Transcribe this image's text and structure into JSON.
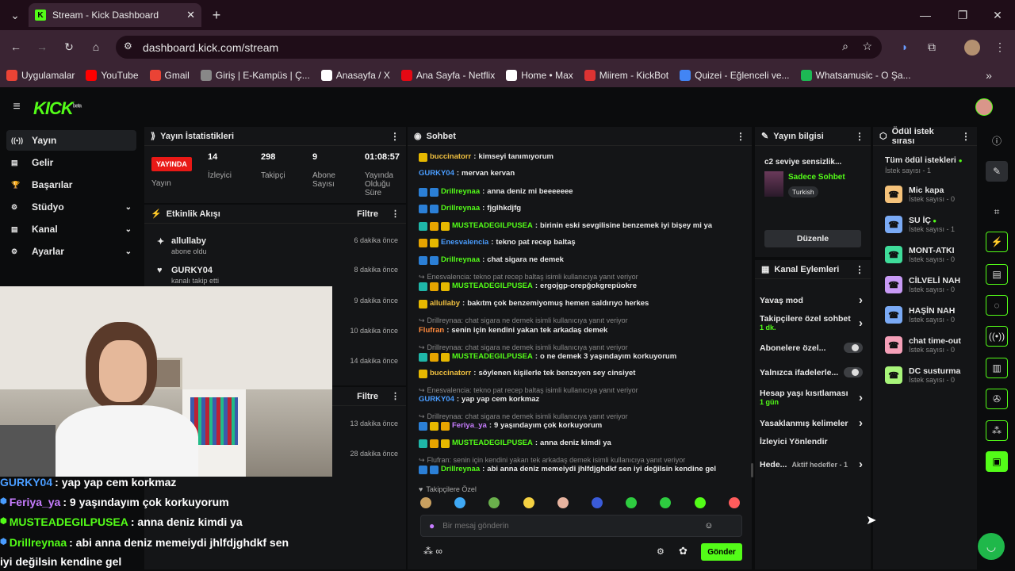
{
  "browser": {
    "tab_title": "Stream - Kick Dashboard",
    "url": "dashboard.kick.com/stream",
    "bookmarks": [
      {
        "label": "Uygulamalar",
        "color": "#ea4335"
      },
      {
        "label": "YouTube",
        "color": "#ff0000"
      },
      {
        "label": "Gmail",
        "color": "#ea4335"
      },
      {
        "label": "Giriş | E-Kampüs | Ç...",
        "color": "#888888"
      },
      {
        "label": "Anasayfa / X",
        "color": "#ffffff"
      },
      {
        "label": "Ana Sayfa - Netflix",
        "color": "#e50914"
      },
      {
        "label": "Home • Max",
        "color": "#ffffff"
      },
      {
        "label": "Miirem - KickBot",
        "color": "#d33"
      },
      {
        "label": "Quizei - Eğlenceli ve...",
        "color": "#4285f4"
      },
      {
        "label": "Whatsamusic - O Şa...",
        "color": "#1db954"
      }
    ]
  },
  "app": {
    "logo": "KICK",
    "logo_sup": "beta"
  },
  "nav": [
    {
      "label": "Yayın",
      "icon": "broadcast-icon"
    },
    {
      "label": "Gelir",
      "icon": "money-icon"
    },
    {
      "label": "Başarılar",
      "icon": "trophy-icon"
    },
    {
      "label": "Stüdyo",
      "icon": "studio-icon"
    },
    {
      "label": "Kanal",
      "icon": "channel-icon"
    },
    {
      "label": "Ayarlar",
      "icon": "gear-icon"
    }
  ],
  "stats": {
    "title": "Yayın İstatistikleri",
    "live": "YAYINDA",
    "live_label": "Yayın",
    "items": [
      {
        "value": "14",
        "label": "İzleyici"
      },
      {
        "value": "298",
        "label": "Takipçi"
      },
      {
        "value": "9",
        "label": "Abone Sayısı"
      },
      {
        "value": "01:08:57",
        "label": "Yayında Olduğu Süre"
      }
    ]
  },
  "activity": {
    "title": "Etkinlik Akışı",
    "filter": "Filtre",
    "items": [
      {
        "user": "allullaby",
        "action": "abone oldu",
        "time": "6 dakika önce"
      },
      {
        "user": "GURKY04",
        "action": "kanalı takip etti",
        "time": "8 dakika önce"
      }
    ],
    "times_hidden": [
      "9 dakika önce",
      "10 dakika önce",
      "14 dakika önce"
    ],
    "filter2": "Filtre",
    "times_hidden2": [
      "13 dakika önce",
      "28 dakika önce"
    ]
  },
  "chat": {
    "title": "Sohbet",
    "messages": [
      {
        "user": "buccinatorr",
        "color": "#f0c040",
        "text": "kimseyi tanımıyorum",
        "badges": [
          "#e6b800"
        ]
      },
      {
        "user": "GURKY04",
        "color": "#4a9dff",
        "text": "mervan kervan",
        "badges": []
      },
      {
        "user": "Drillreynaa",
        "color": "#53fc18",
        "text": "anna deniz mi beeeeeee",
        "badges": [
          "#2b7fd6",
          "#2b7fd6"
        ]
      },
      {
        "user": "Drillreynaa",
        "color": "#53fc18",
        "text": "fjglhkdjfg",
        "badges": [
          "#2b7fd6",
          "#2b7fd6"
        ]
      },
      {
        "user": "MUSTEADEGILPUSEA",
        "color": "#53fc18",
        "text": "birinin eski sevgilisine benzemek iyi bişey mi ya",
        "badges": [
          "#1fb6a8",
          "#e6a400",
          "#e6b800"
        ]
      },
      {
        "user": "Enesvalencia",
        "color": "#4a9dff",
        "text": "tekno pat recep baltaş",
        "badges": [
          "#e6a400",
          "#e6b800"
        ]
      },
      {
        "user": "Drillreynaa",
        "color": "#53fc18",
        "text": "chat sigara ne demek",
        "badges": [
          "#2b7fd6",
          "#2b7fd6"
        ]
      },
      {
        "reply": "Enesvalencia: tekno pat recep baltaş isimli kullanıcıya yanıt veriyor"
      },
      {
        "user": "MUSTEADEGILPUSEA",
        "color": "#53fc18",
        "text": "ergojgp-orepğokgrepüokre",
        "badges": [
          "#1fb6a8",
          "#e6a400",
          "#e6b800"
        ]
      },
      {
        "user": "allullaby",
        "color": "#f0c040",
        "text": "bakıtm çok benzemiyomuş hemen saldırıyo herkes",
        "badges": [
          "#e6b800"
        ]
      },
      {
        "reply": "Drillreynaa: chat sigara ne demek isimli kullanıcıya yanıt veriyor"
      },
      {
        "user": "Flufran",
        "color": "#ff8a3d",
        "text": "senin için kendini yakan tek arkadaş demek",
        "badges": []
      },
      {
        "reply": "Drillreynaa: chat sigara ne demek isimli kullanıcıya yanıt veriyor"
      },
      {
        "user": "MUSTEADEGILPUSEA",
        "color": "#53fc18",
        "text": "o ne demek 3 yaşındayım korkuyorum",
        "badges": [
          "#1fb6a8",
          "#e6a400",
          "#e6b800"
        ]
      },
      {
        "user": "buccinatorr",
        "color": "#f0c040",
        "text": "söylenen kişilerle tek benzeyen sey cinsiyet",
        "badges": [
          "#e6b800"
        ]
      },
      {
        "reply": "Enesvalencia: tekno pat recep baltaş isimli kullanıcıya yanıt veriyor"
      },
      {
        "user": "GURKY04",
        "color": "#4a9dff",
        "text": "yap yap cem korkmaz",
        "badges": []
      },
      {
        "reply": "Drillreynaa: chat sigara ne demek isimli kullanıcıya yanıt veriyor"
      },
      {
        "user": "Feriya_ya",
        "color": "#c77dff",
        "text": "9 yaşındayım çok korkuyorum",
        "badges": [
          "#2b7fd6",
          "#e6b800",
          "#e6a400"
        ]
      },
      {
        "user": "MUSTEADEGILPUSEA",
        "color": "#53fc18",
        "text": "anna deniz kimdi ya",
        "badges": [
          "#1fb6a8",
          "#e6a400",
          "#e6b800"
        ]
      },
      {
        "reply": "Flufran: senin için kendini yakan tek arkadaş demek isimli kullanıcıya yanıt veriyor"
      },
      {
        "user": "Drillreynaa",
        "color": "#53fc18",
        "text": "abi anna deniz memeiydi jhlfdjghdkf sen iyi değilsin kendine gel",
        "badges": [
          "#2b7fd6",
          "#2b7fd6"
        ]
      }
    ],
    "followers_only": "Takipçilere Özel",
    "emotes": [
      "#c9a060",
      "#3fa9f5",
      "#6ab04c",
      "#f5d142",
      "#e8b4a0",
      "#3a5bd9",
      "#2ecc40",
      "#2ecc40",
      "#53fc18",
      "#ff5c5c"
    ],
    "input_placeholder": "Bir mesaj gönderin",
    "send": "Gönder"
  },
  "stream_info": {
    "title": "Yayın bilgisi",
    "stream_title": "c2 seviye sensizlik...",
    "category": "Sadece Sohbet",
    "tag": "Turkish",
    "edit": "Düzenle"
  },
  "channel_actions": {
    "title": "Kanal Eylemleri",
    "items": [
      {
        "label": "Yavaş mod",
        "sub": "",
        "control": "chevron"
      },
      {
        "label": "Takipçilere özel sohbet",
        "sub": "1 dk.",
        "control": "chevron"
      },
      {
        "label": "Abonelere özel...",
        "sub": "",
        "control": "toggle"
      },
      {
        "label": "Yalnızca ifadelerle...",
        "sub": "",
        "control": "toggle"
      },
      {
        "label": "Hesap yaşı kısıtlaması",
        "sub": "1 gün",
        "control": "chevron"
      },
      {
        "label": "Yasaklanmış kelimeler",
        "sub": "",
        "control": "chevron"
      },
      {
        "label": "İzleyici Yönlendir",
        "sub": "",
        "control": "none"
      },
      {
        "label": "Hede...",
        "sub": "Aktif hedefler - 1",
        "control": "chevron"
      }
    ]
  },
  "rewards": {
    "title": "Ödül istek sırası",
    "all": "Tüm ödül istekleri",
    "all_count": "İstek sayısı - 1",
    "items": [
      {
        "name": "Mic kapa",
        "count": "İstek sayısı - 0",
        "color": "#f5c27a"
      },
      {
        "name": "SU İÇ",
        "count": "İstek sayısı - 1",
        "color": "#7aaaf5"
      },
      {
        "name": "MONT-ATKI",
        "count": "İstek sayısı - 0",
        "color": "#3fdc9a"
      },
      {
        "name": "CİLVELİ NAH",
        "count": "İstek sayısı - 0",
        "color": "#c89af5"
      },
      {
        "name": "HAŞİN NAH",
        "count": "İstek sayısı - 0",
        "color": "#7aaaf5"
      },
      {
        "name": "chat time-out",
        "count": "İstek sayısı - 0",
        "color": "#f5a0b8"
      },
      {
        "name": "DC susturma",
        "count": "İstek sayısı - 0",
        "color": "#a8f57a"
      }
    ]
  },
  "overlay": {
    "lines": [
      {
        "user": "GURKY04",
        "color": "#4a9dff",
        "text": ": yap yap cem korkmaz"
      },
      {
        "user": "Feriya_ya",
        "color": "#c77dff",
        "text": ": 9 yaşındayım çok korkuyorum"
      },
      {
        "user": "MUSTEADEGILPUSEA",
        "color": "#53fc18",
        "text": ": anna deniz kimdi ya"
      },
      {
        "user": "Drillreynaa",
        "color": "#53fc18",
        "text": ": abi anna deniz memeiydi jhlfdjghdkf sen"
      },
      {
        "user": "",
        "color": "#ffffff",
        "text": "iyi değilsin kendine gel"
      }
    ]
  }
}
